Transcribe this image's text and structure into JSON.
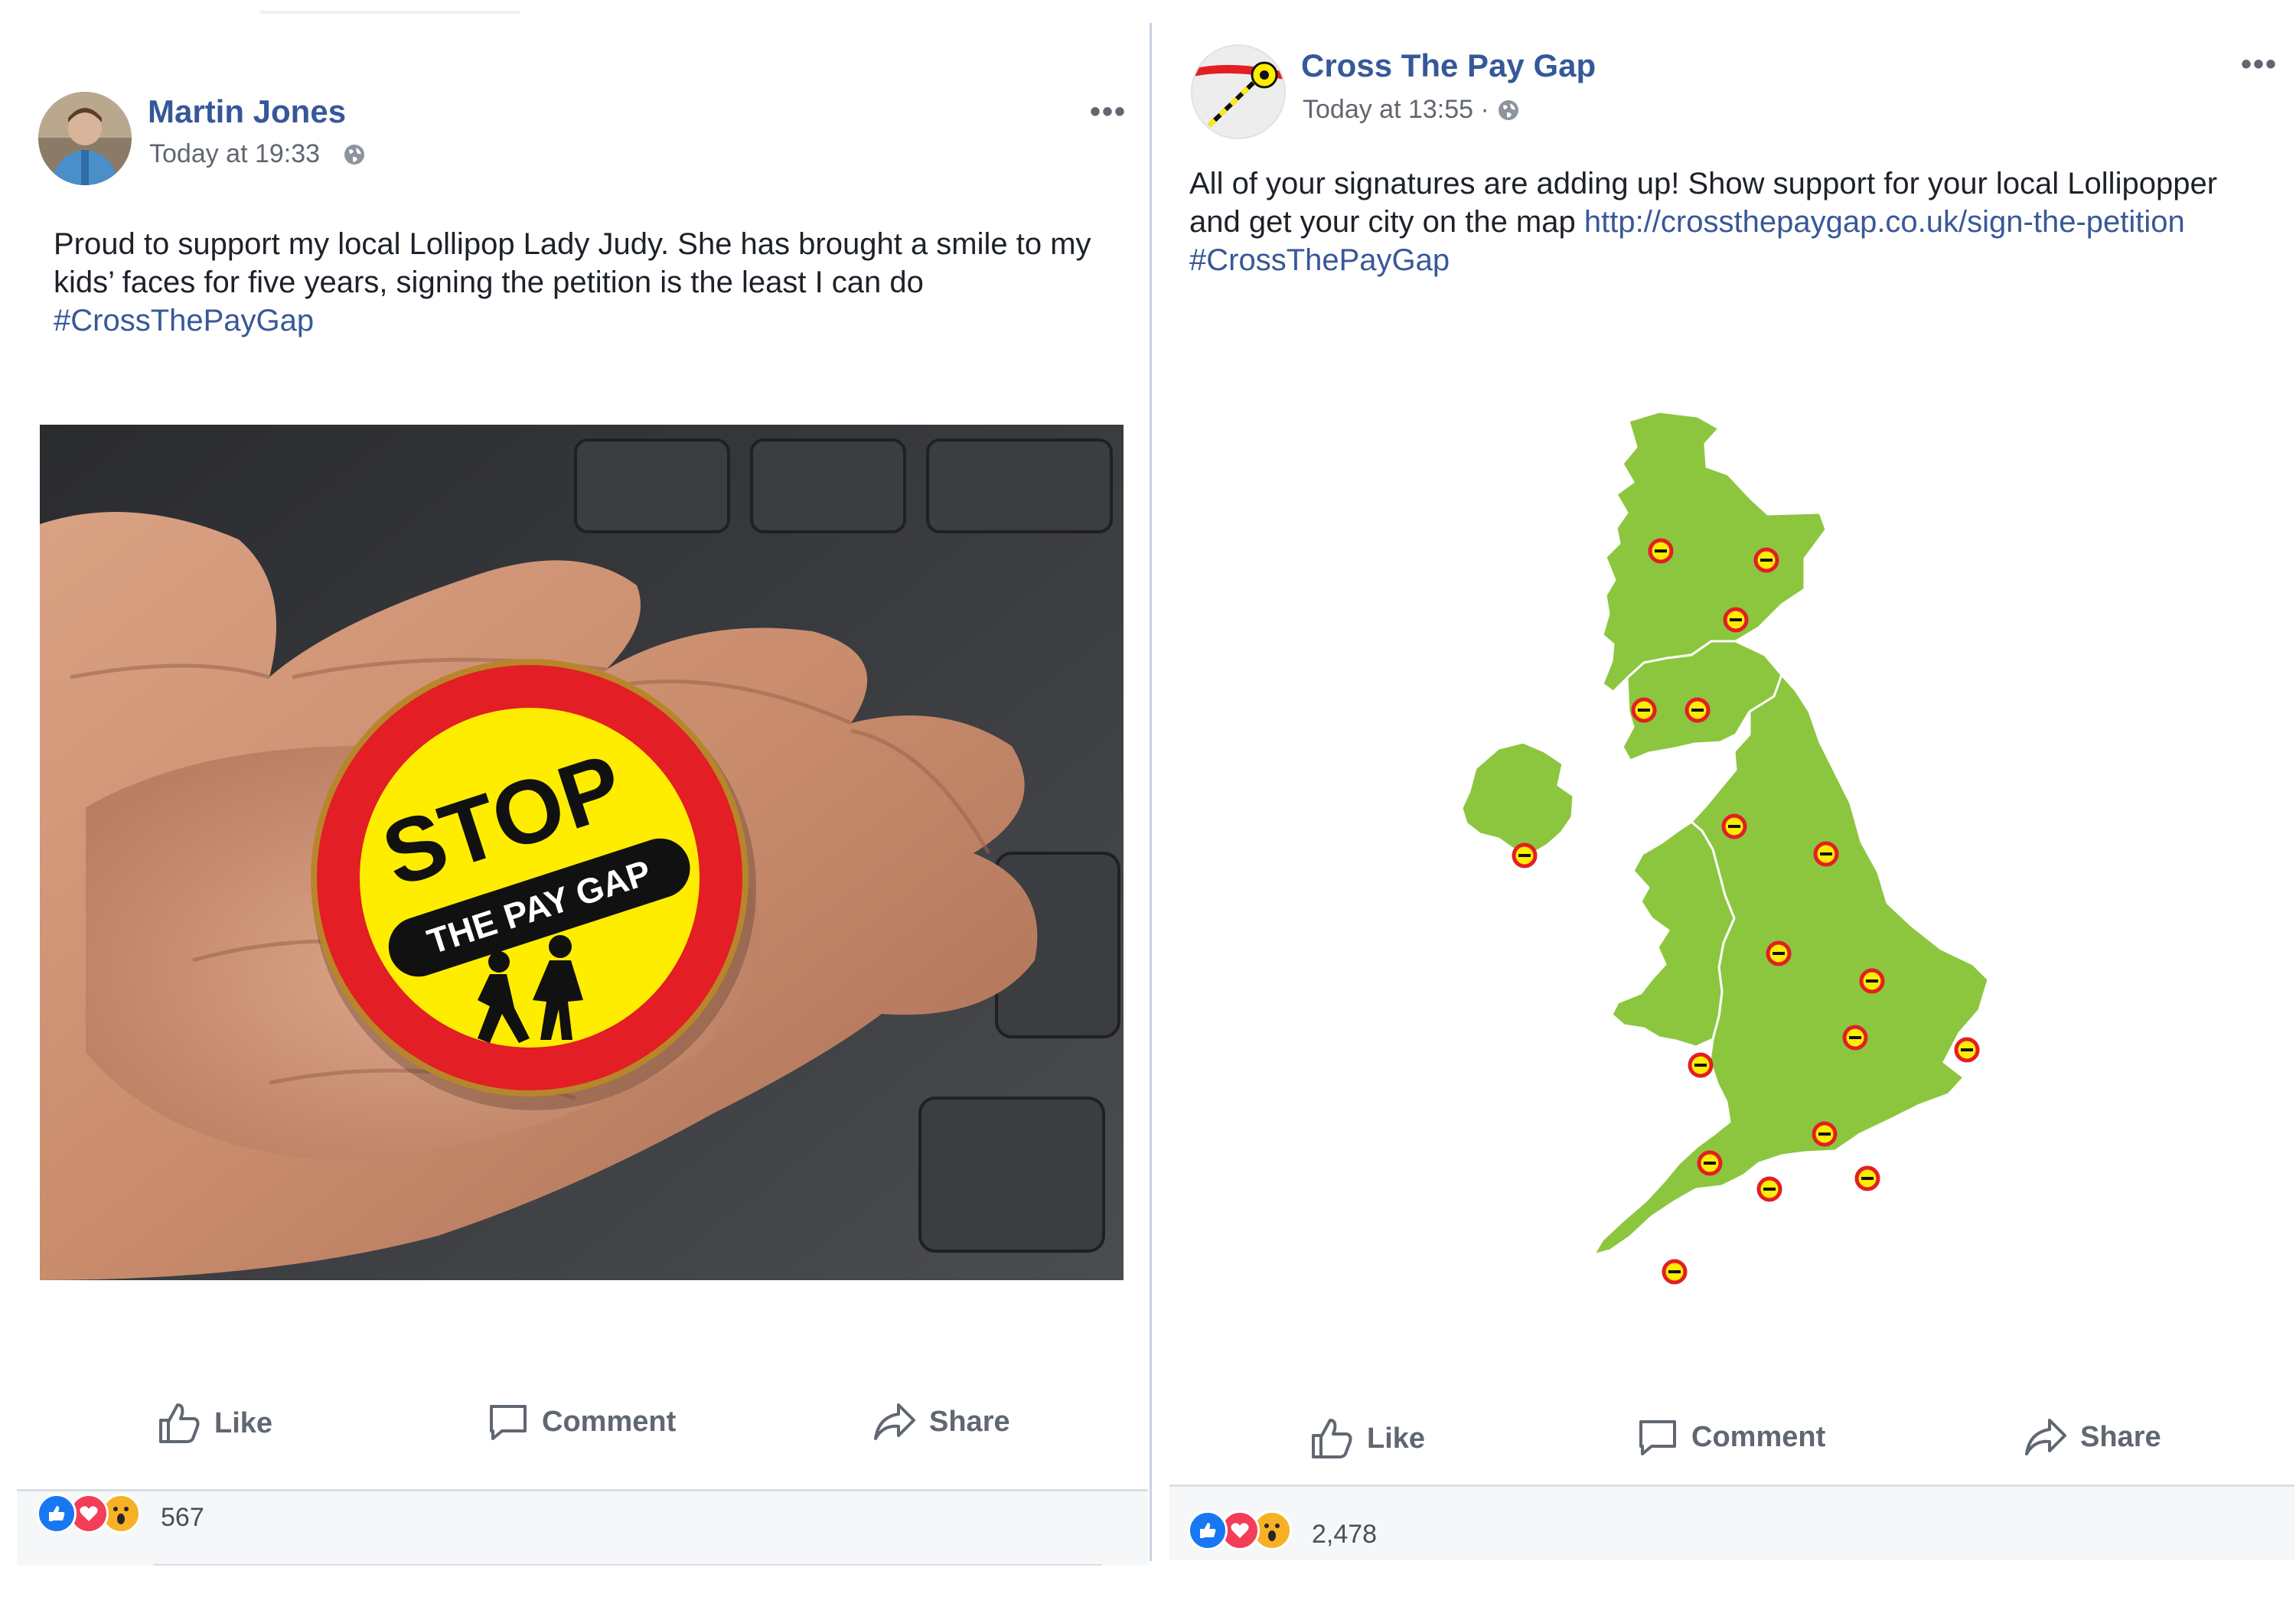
{
  "left_post": {
    "author": "Martin Jones",
    "timestamp": "Today at 19:33",
    "privacy_icon": "globe-icon",
    "more_label": "•••",
    "text": "Proud to support my local Lollipop Lady Judy. She has brought a smile to my kids’ faces for five years, signing the petition is the least I can do",
    "hashtag": "#CrossThePayGap",
    "badge": {
      "word": "STOP",
      "band": "THE PAY GAP"
    },
    "actions": {
      "like": "Like",
      "comment": "Comment",
      "share": "Share"
    },
    "reaction_count": "567"
  },
  "right_post": {
    "author": "Cross The Pay Gap",
    "timestamp": "Today at 13:55 ·",
    "privacy_icon": "globe-icon",
    "more_label": "•••",
    "text_line1": "All of your signatures are adding up! Show support for your local Lollipopper",
    "text_line2_prefix": "and get your city on the map ",
    "link": "http://crossthepaygap.co.uk/sign-the-petition",
    "hashtag": "#CrossThePayGap",
    "actions": {
      "like": "Like",
      "comment": "Comment",
      "share": "Share"
    },
    "reaction_count": "2,478"
  },
  "colors": {
    "name_blue": "#365899",
    "link_blue": "#385898",
    "map_green": "#8cc63f",
    "badge_red": "#e31e24",
    "badge_yellow": "#ffed00",
    "like_blue": "#1877f2",
    "love_red": "#f33e58"
  }
}
